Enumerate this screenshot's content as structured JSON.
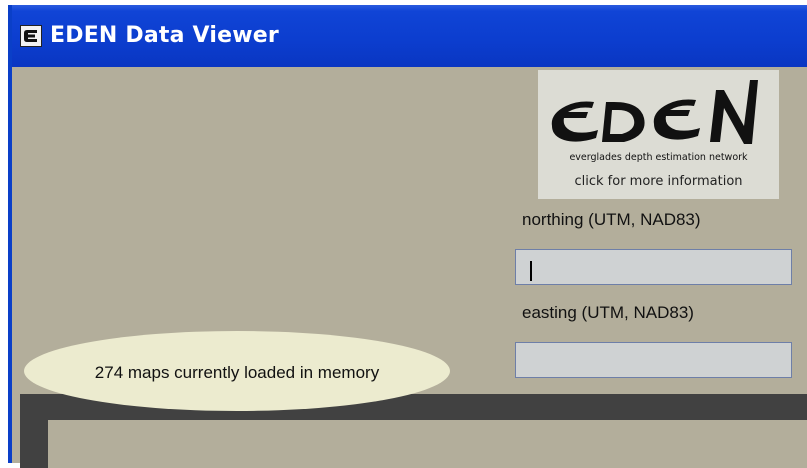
{
  "window": {
    "title": "EDEN Data Viewer",
    "titlebar_color": "#0a3fc8",
    "background_color": "#b3ae9b"
  },
  "logo": {
    "wordmark": "EDEN",
    "tagline": "everglades depth estimation network",
    "link_text": "click for more information"
  },
  "northing": {
    "label": "northing (UTM, NAD83)",
    "value": ""
  },
  "easting": {
    "label": "easting (UTM, NAD83)",
    "value": ""
  },
  "status": {
    "text": "274 maps currently loaded in memory"
  }
}
